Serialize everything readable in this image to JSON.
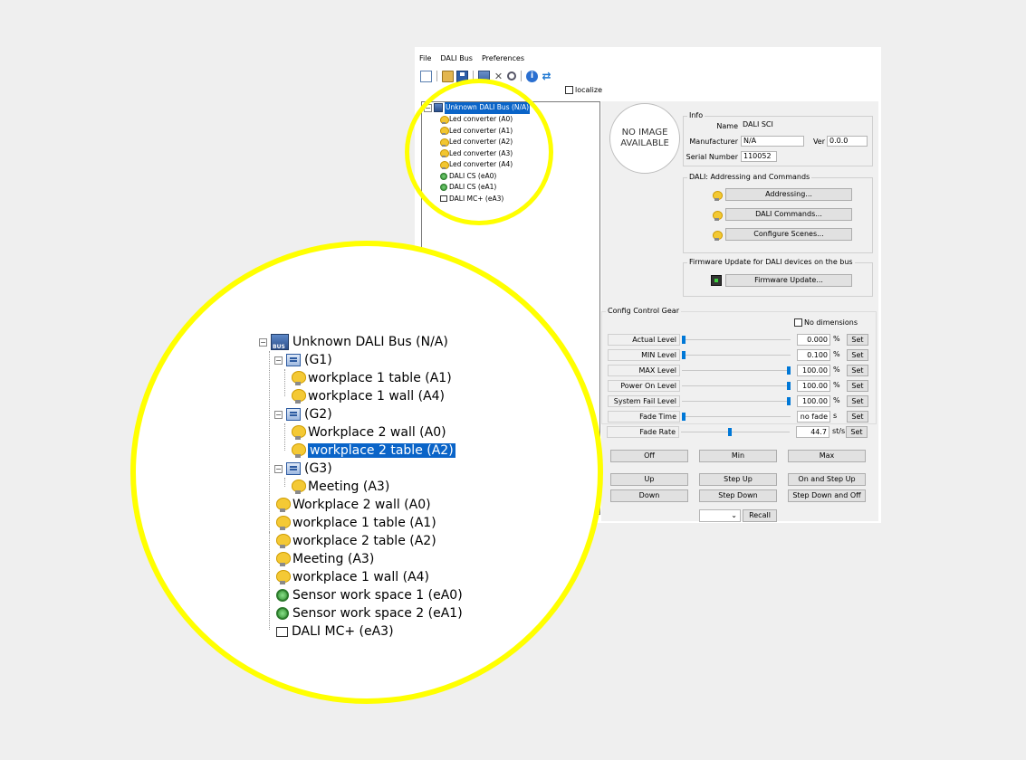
{
  "menu": [
    "File",
    "DALI Bus",
    "Preferences"
  ],
  "toolbar_icons": [
    "new-page-icon",
    "open-folder-icon",
    "save-icon",
    "network-icon",
    "tools-icon",
    "find-icon",
    "info-icon",
    "refresh-icon"
  ],
  "localize_label": "localize",
  "small_tree": {
    "root": "Unknown DALI Bus (N/A)",
    "items": [
      {
        "label": "Led converter (A0)",
        "icon": "bulb-icon"
      },
      {
        "label": "Led converter (A1)",
        "icon": "bulb-icon"
      },
      {
        "label": "Led converter (A2)",
        "icon": "bulb-icon"
      },
      {
        "label": "Led converter (A3)",
        "icon": "bulb-icon"
      },
      {
        "label": "Led converter (A4)",
        "icon": "bulb-icon"
      },
      {
        "label": "DALI CS (eA0)",
        "icon": "sensor-icon"
      },
      {
        "label": "DALI CS (eA1)",
        "icon": "sensor-icon"
      },
      {
        "label": "DALI MC+ (eA3)",
        "icon": "box-icon"
      }
    ]
  },
  "no_image": "NO IMAGE\nAVAILABLE",
  "info": {
    "title": "Info",
    "name_label": "Name",
    "name_value": "DALI SCI",
    "manufacturer_label": "Manufacturer",
    "manufacturer_value": "N/A",
    "ver_label": "Ver",
    "ver_value": "0.0.0",
    "serial_label": "Serial Number",
    "serial_value": "110052"
  },
  "addressing": {
    "title": "DALI: Addressing and Commands",
    "buttons": [
      "Addressing...",
      "DALI Commands...",
      "Configure Scenes..."
    ]
  },
  "firmware": {
    "title": "Firmware Update for DALI devices on the bus",
    "button": "Firmware Update..."
  },
  "config": {
    "title": "Config Control Gear",
    "no_dimensions": "No dimensions",
    "rows": [
      {
        "label": "Actual Level",
        "value": "0.000",
        "unit": "%",
        "level": 0.0
      },
      {
        "label": "MIN Level",
        "value": "0.100",
        "unit": "%",
        "level": 0.0
      },
      {
        "label": "MAX Level",
        "value": "100.00",
        "unit": "%",
        "level": 1.0
      },
      {
        "label": "Power On Level",
        "value": "100.00",
        "unit": "%",
        "level": 1.0
      },
      {
        "label": "System Fail Level",
        "value": "100.00",
        "unit": "%",
        "level": 1.0
      },
      {
        "label": "Fade Time",
        "value": "no fade",
        "unit": "s",
        "level": 0.0
      },
      {
        "label": "Fade Rate",
        "value": "44.7",
        "unit": "st/s",
        "level": 0.45
      }
    ],
    "set_label": "Set"
  },
  "commands": {
    "row1": [
      "Off",
      "Min",
      "Max"
    ],
    "row2": [
      "Up",
      "Step Up",
      "On and Step Up"
    ],
    "row3": [
      "Down",
      "Step Down",
      "Step Down and Off"
    ],
    "recall": "Recall"
  },
  "big_tree": {
    "root": "Unknown DALI Bus (N/A)",
    "groups": [
      {
        "label": "(G1)",
        "items": [
          "workplace 1 table (A1)",
          "workplace 1 wall (A4)"
        ]
      },
      {
        "label": "(G2)",
        "items": [
          "Workplace 2 wall (A0)",
          "workplace 2 table (A2)"
        ]
      },
      {
        "label": "(G3)",
        "items": [
          "Meeting (A3)"
        ]
      }
    ],
    "devices": [
      {
        "label": "Workplace 2 wall (A0)",
        "icon": "bulb-icon"
      },
      {
        "label": "workplace 1 table (A1)",
        "icon": "bulb-icon"
      },
      {
        "label": "workplace 2 table (A2)",
        "icon": "bulb-icon"
      },
      {
        "label": "Meeting (A3)",
        "icon": "bulb-icon"
      },
      {
        "label": "workplace 1 wall (A4)",
        "icon": "bulb-icon"
      },
      {
        "label": "Sensor work space 1 (eA0)",
        "icon": "sensor-icon"
      },
      {
        "label": "Sensor work space 2 (eA1)",
        "icon": "sensor-icon"
      },
      {
        "label": "DALI MC+ (eA3)",
        "icon": "box-icon"
      }
    ]
  },
  "colors": {
    "highlight": "#ffff00",
    "selection": "#0a64c8",
    "slider": "#0078d7"
  }
}
